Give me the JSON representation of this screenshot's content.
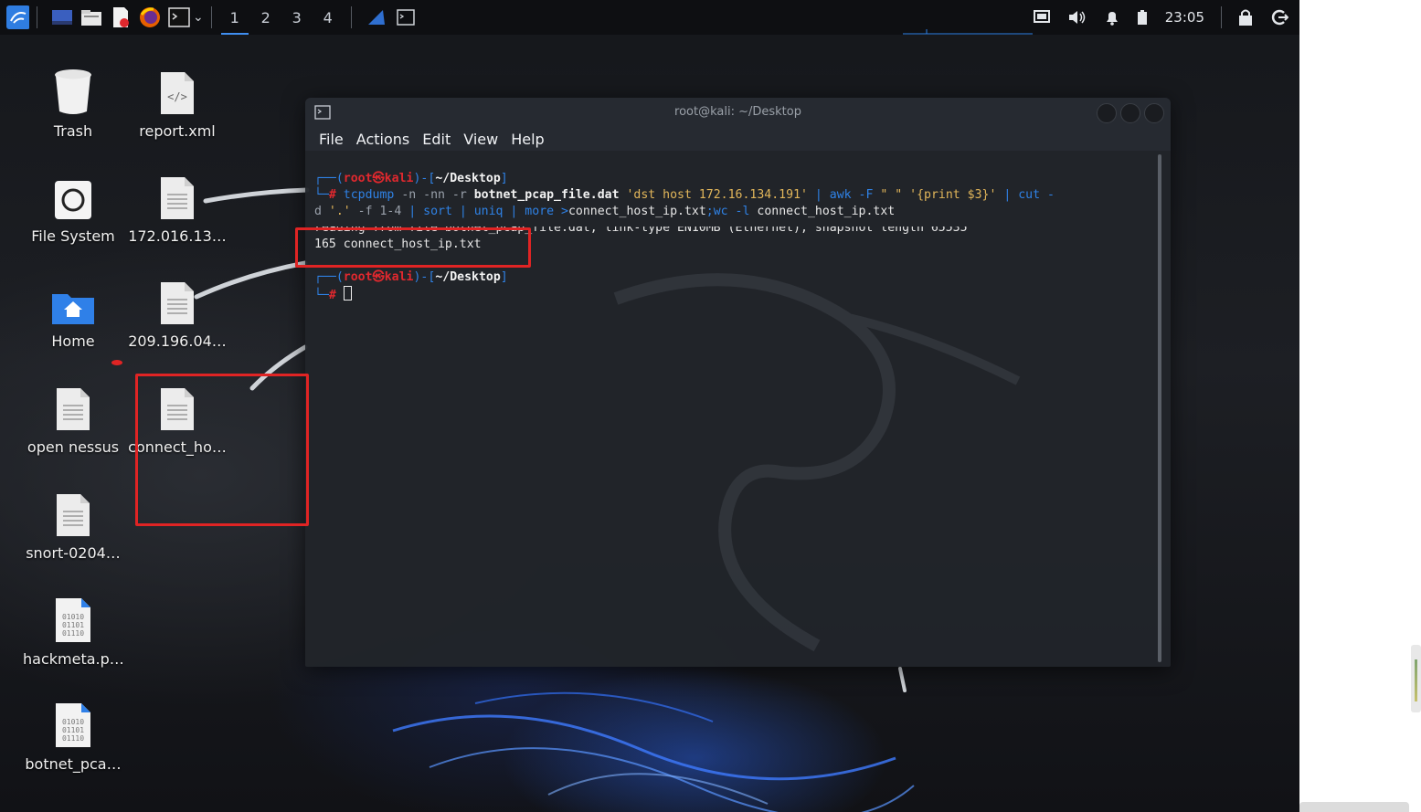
{
  "taskbar": {
    "workspaces": [
      "1",
      "2",
      "3",
      "4"
    ],
    "active_workspace": "1",
    "clock": "23:05"
  },
  "desktop_icons": [
    {
      "name": "trash",
      "label": "Trash",
      "icon": "trash-icon"
    },
    {
      "name": "report-xml",
      "label": "report.xml",
      "icon": "xml-file-icon"
    },
    {
      "name": "file-system",
      "label": "File System",
      "icon": "drive-icon"
    },
    {
      "name": "file-172",
      "label": "172.016.13…",
      "icon": "text-file-icon"
    },
    {
      "name": "home",
      "label": "Home",
      "icon": "home-folder-icon"
    },
    {
      "name": "file-209",
      "label": "209.196.04…",
      "icon": "text-file-icon"
    },
    {
      "name": "open-nessus",
      "label": "open nessus",
      "icon": "text-file-icon"
    },
    {
      "name": "connect-ho",
      "label": "connect_ho…",
      "icon": "text-file-icon"
    },
    {
      "name": "snort",
      "label": "snort-0204…",
      "icon": "text-file-icon"
    },
    {
      "name": "hackmeta",
      "label": "hackmeta.p…",
      "icon": "binary-file-icon"
    },
    {
      "name": "botnet-pca",
      "label": "botnet_pca…",
      "icon": "binary-file-icon"
    }
  ],
  "terminal": {
    "title": "root@kali: ~/Desktop",
    "menu": [
      "File",
      "Actions",
      "Edit",
      "View",
      "Help"
    ],
    "prompt": {
      "open": "┌──(",
      "user": "root",
      "at": "㉿",
      "host": "kali",
      "mid": ")-[",
      "path": "~/Desktop",
      "close": "]",
      "second": "└─",
      "hash": "#"
    },
    "cmd": {
      "c1": " tcpdump ",
      "c2": "-n -nn -r ",
      "c3": "botnet_pcap_file.dat",
      "c4": " 'dst host 172.16.134.191'",
      "c5": " | ",
      "c6": "awk -F ",
      "c7": "\" \"",
      "c8": " '{print $3}'",
      "c9": " | ",
      "c10": "cut -",
      "l2a": "d ",
      "l2b": "'.'",
      "l2c": " -f 1-4 ",
      "l2d": "| sort | uniq | more ",
      "l2e": ">",
      "l2f": "connect_host_ip.txt",
      "l2g": ";wc -l ",
      "l2h": "connect_host_ip.txt"
    },
    "output": [
      "reading from file botnet_pcap_file.dat, link-type EN10MB (Ethernet), snapshot length 65535",
      "165 connect_host_ip.txt"
    ]
  },
  "colors": {
    "prompt_blue": "#2f82e6",
    "prompt_red": "#e0282e",
    "highlight_box": "#e02424"
  }
}
